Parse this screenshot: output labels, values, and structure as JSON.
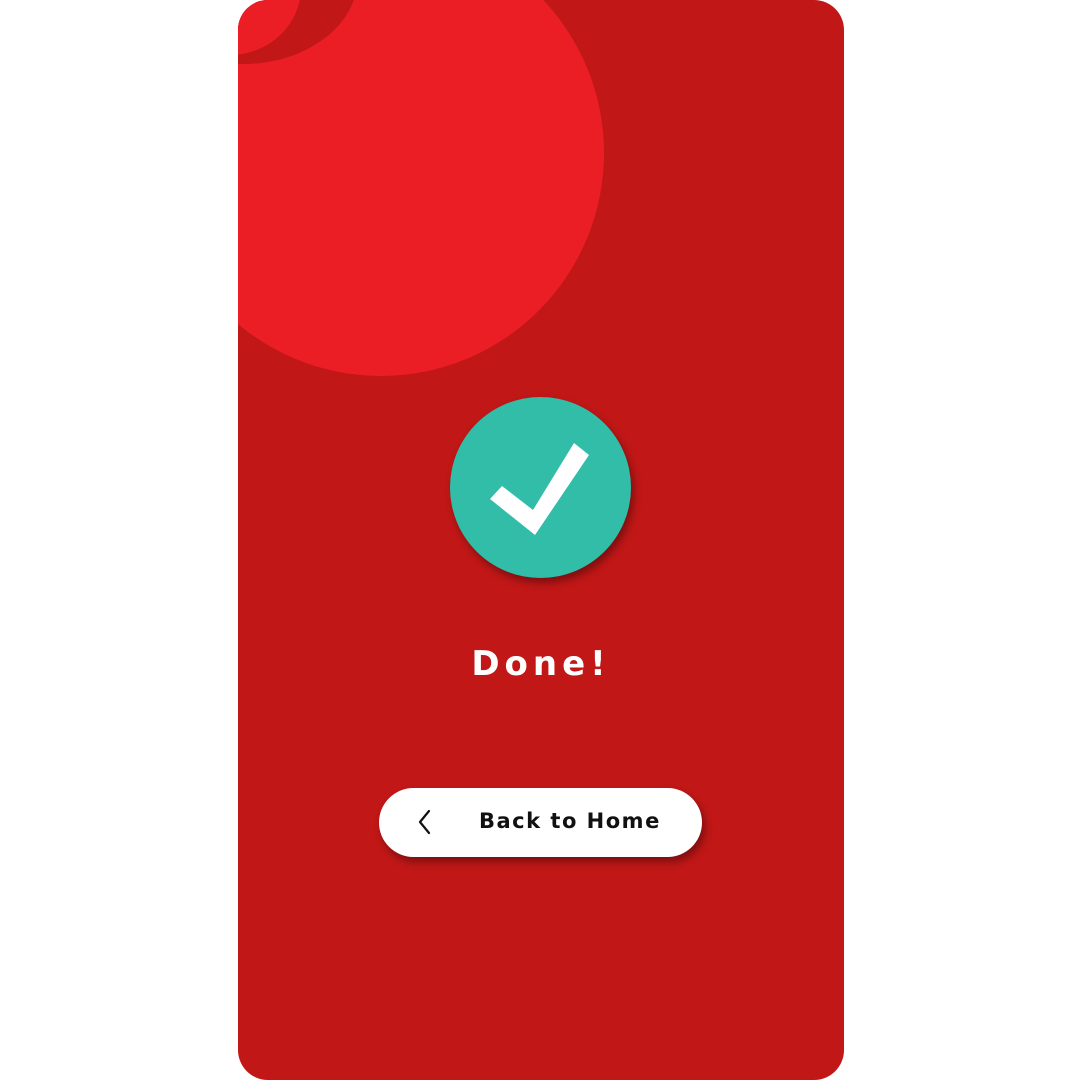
{
  "status": {
    "title": "Done!"
  },
  "actions": {
    "back_label": "Back to Home",
    "back_icon": "chevron-left-icon"
  },
  "icons": {
    "status_icon": "checkmark-icon"
  },
  "colors": {
    "background": "#c11717",
    "accent_blob": "#ec1e25",
    "success": "#31bda8",
    "button_bg": "#ffffff",
    "button_text": "#111111"
  }
}
